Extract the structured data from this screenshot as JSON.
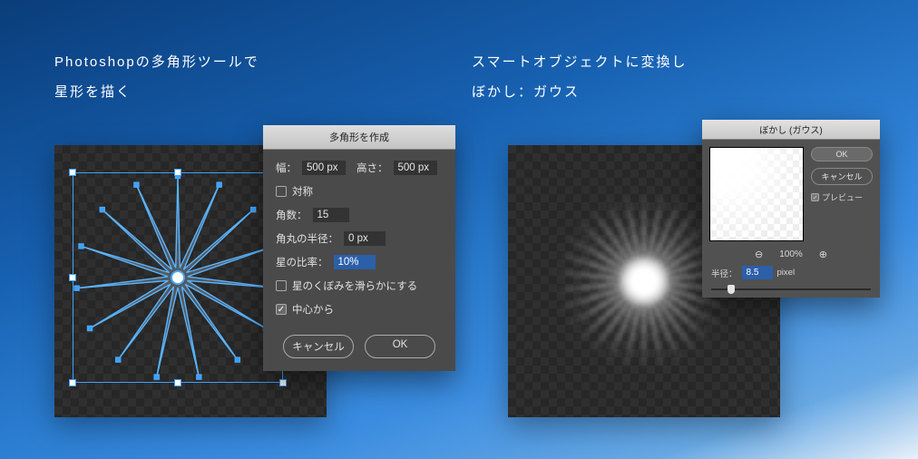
{
  "captions": {
    "left": "Photoshopの多角形ツールで\n星形を描く",
    "right": "スマートオブジェクトに変換し\nぼかし：ガウス"
  },
  "polygon_dialog": {
    "title": "多角形を作成",
    "width_label": "幅：",
    "width_value": "500 px",
    "height_label": "高さ：",
    "height_value": "500 px",
    "symmetric_label": "対称",
    "symmetric_checked": false,
    "sides_label": "角数：",
    "sides_value": "15",
    "corner_radius_label": "角丸の半径：",
    "corner_radius_value": "0 px",
    "star_ratio_label": "星の比率：",
    "star_ratio_value": "10%",
    "smooth_indent_label": "星のくぼみを滑らかにする",
    "smooth_indent_checked": false,
    "from_center_label": "中心から",
    "from_center_checked": true,
    "cancel": "キャンセル",
    "ok": "OK"
  },
  "gaussian_dialog": {
    "title": "ぼかし (ガウス)",
    "ok": "OK",
    "cancel": "キャンセル",
    "preview_label": "プレビュー",
    "preview_checked": true,
    "zoom_percent": "100%",
    "radius_label": "半径：",
    "radius_value": "8.5",
    "radius_unit": "pixel"
  },
  "star": {
    "spokes": 15
  }
}
